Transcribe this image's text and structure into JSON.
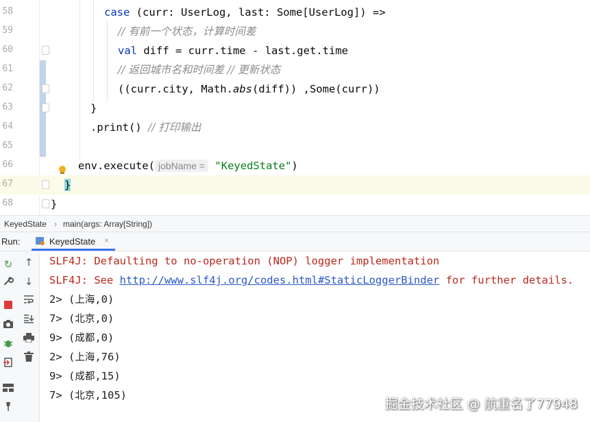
{
  "editor": {
    "lines": [
      {
        "no": "58",
        "text": "case (curr: UserLog, last: Some[UserLog]) =>"
      },
      {
        "no": "59",
        "text": "// 有前一个状态，计算时间差"
      },
      {
        "no": "60",
        "text": "val diff = curr.time - last.get.time"
      },
      {
        "no": "61",
        "text": "// 返回城市名和时间差 // 更新状态"
      },
      {
        "no": "62",
        "text": "((curr.city, Math.abs(diff)) ,Some(curr))"
      },
      {
        "no": "63",
        "text": "}"
      },
      {
        "no": "64",
        "text": ".print() // 打印输出"
      },
      {
        "no": "65",
        "text": ""
      },
      {
        "no": "66",
        "text": "env.execute( jobName = \"KeyedState\")"
      },
      {
        "no": "67",
        "text": "}"
      },
      {
        "no": "68",
        "text": "}"
      }
    ],
    "tokens": {
      "case_kw": "case",
      "l58_rest": " (curr: UserLog, last: Some[UserLog]) =>",
      "l59_comment": "// 有前一个状态，计算时间差",
      "val_kw": "val",
      "l60_rest": " diff = curr.time - last.get.time",
      "l61_comment": "// 返回城市名和时间差 // 更新状态",
      "l62_a": "((curr.city, Math.",
      "l62_abs": "abs",
      "l62_b": "(diff)) ,Some(curr))",
      "l63": "}",
      "l64_code": ".print() ",
      "l64_comment": "// 打印输出",
      "l66_a": "env.execute(",
      "l66_hint": "jobName =",
      "l66_str": "\"KeyedState\"",
      "l66_b": ")",
      "l67": "}",
      "l68": "}"
    }
  },
  "breadcrumb": {
    "items": [
      "KeyedState",
      "main(args: Array[String])"
    ],
    "separator": "›"
  },
  "run_panel": {
    "label": "Run:",
    "tab_label": "KeyedState",
    "tab_close": "×"
  },
  "console": {
    "line1": "SLF4J: Defaulting to no-operation (NOP) logger implementation",
    "line2_prefix": "SLF4J: See ",
    "line2_link": "http://www.slf4j.org/codes.html#StaticLoggerBinder",
    "line2_suffix": " for further details.",
    "outputs": [
      {
        "prefix": "2> (",
        "city": "上海",
        "value": ",0)"
      },
      {
        "prefix": "7> (",
        "city": "北京",
        "value": ",0)"
      },
      {
        "prefix": "9> (",
        "city": "成都",
        "value": ",0)"
      },
      {
        "prefix": "2> (",
        "city": "上海",
        "value": ",76)"
      },
      {
        "prefix": "9> (",
        "city": "成都",
        "value": ",15)"
      },
      {
        "prefix": "7> (",
        "city": "北京",
        "value": ",105)"
      }
    ]
  },
  "watermark": "掘金技术社区 @ 航重名了77948",
  "colors": {
    "keyword": "#0033b3",
    "comment": "#8c8c8c",
    "string": "#067d17",
    "error": "#b9271e",
    "link": "#2a58c9",
    "current_line": "#fcfbe9",
    "brace_highlight": "#93d9d9"
  },
  "icons": {
    "toolbar_left": [
      "rerun-icon",
      "settings-wrench-icon",
      "stop-icon",
      "camera-icon",
      "debug-bug-icon",
      "login-exit-icon",
      "layout-icon",
      "pin-icon"
    ],
    "toolbar_right": [
      "scroll-up-icon",
      "scroll-down-icon",
      "soft-wrap-icon",
      "scroll-to-end-icon",
      "print-icon",
      "clear-trash-icon"
    ]
  }
}
